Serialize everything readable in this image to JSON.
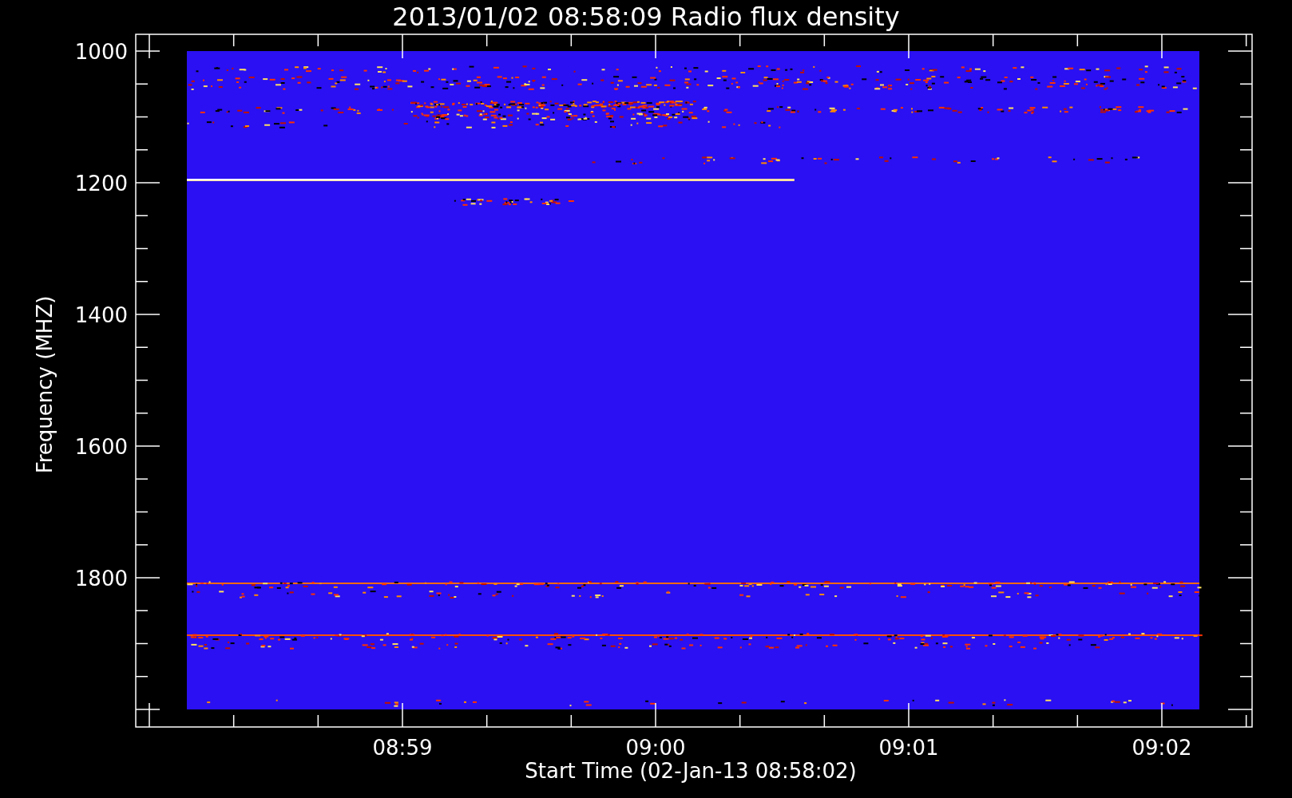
{
  "title": "2013/01/02 08:58:09 Radio flux density",
  "y_axis": {
    "label": "Frequency (MHZ)",
    "ticks": [
      "1000",
      "1200",
      "1400",
      "1600",
      "1800"
    ]
  },
  "x_axis": {
    "label": "Start Time (02-Jan-13 08:58:02)",
    "ticks": [
      "08:59",
      "09:00",
      "09:01",
      "09:02"
    ]
  }
}
